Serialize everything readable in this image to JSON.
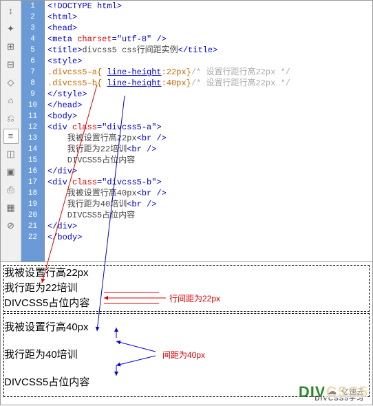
{
  "toolbar": {
    "icons": [
      "↕",
      "✦",
      "⊞",
      "⊟",
      "◇",
      "⌂",
      "⎌",
      "≡",
      "◫",
      "▣",
      "⎙",
      "▦",
      "⊘"
    ]
  },
  "lines": [
    "1",
    "2",
    "3",
    "4",
    "5",
    "6",
    "7",
    "8",
    "9",
    "10",
    "11",
    "12",
    "13",
    "14",
    "15",
    "16",
    "17",
    "18",
    "19",
    "20",
    "21",
    "22"
  ],
  "code": {
    "l1": "<!DOCTYPE html>",
    "l2": "<html>",
    "l3": "<head>",
    "l4a": "<meta ",
    "l4b": "charset",
    "l4c": "=\"utf-8\"",
    "l4d": " />",
    "l5a": "<title>",
    "l5b": "divcss5 css行间距实例",
    "l5c": "</title>",
    "l6": "<style>",
    "l7a": ".divcss5-a{ ",
    "l7b": "line-height",
    "l7c": ":22px}",
    "l7d": "/* 设置行距行高22px */",
    "l8a": ".divcss5-b{ ",
    "l8b": "line-height",
    "l8c": ":40px}",
    "l8d": "/* 设置行距行高22px */",
    "l9": "</style>",
    "l10": "</head>",
    "l11": "<body>",
    "l12a": "<div ",
    "l12b": "class",
    "l12c": "=\"divcss5-a\"",
    "l12d": ">",
    "l13a": "    我被设置行高22px",
    "l13b": "<br />",
    "l14a": "    我行距为22培训",
    "l14b": "<br />",
    "l15": "    DIVCSS5占位内容",
    "l16": "</div>",
    "l17a": "<div ",
    "l17b": "class",
    "l17c": "=\"divcss5-b\"",
    "l17d": ">",
    "l18a": "    我被设置行高40px",
    "l18b": "<br />",
    "l19a": "    我行距为40培训",
    "l19b": "<br />",
    "l20": "    DIVCSS5占位内容",
    "l21": "</div>",
    "l22": "</body>"
  },
  "preview": {
    "a1": "我被设置行高22px",
    "a2": "我行距为22培训",
    "a3": "DIVCSS5占位内容",
    "b1": "我被设置行高40px",
    "b2": "我行距为40培训",
    "b3": "DIVCSS5占位内容",
    "anno1": "行间距为22px",
    "anno2": "间距为40px"
  },
  "logo": {
    "part1": "DIV",
    "part2": "CSS5",
    "sub": "DIVCSS5学习"
  },
  "watermark": "亿速云"
}
